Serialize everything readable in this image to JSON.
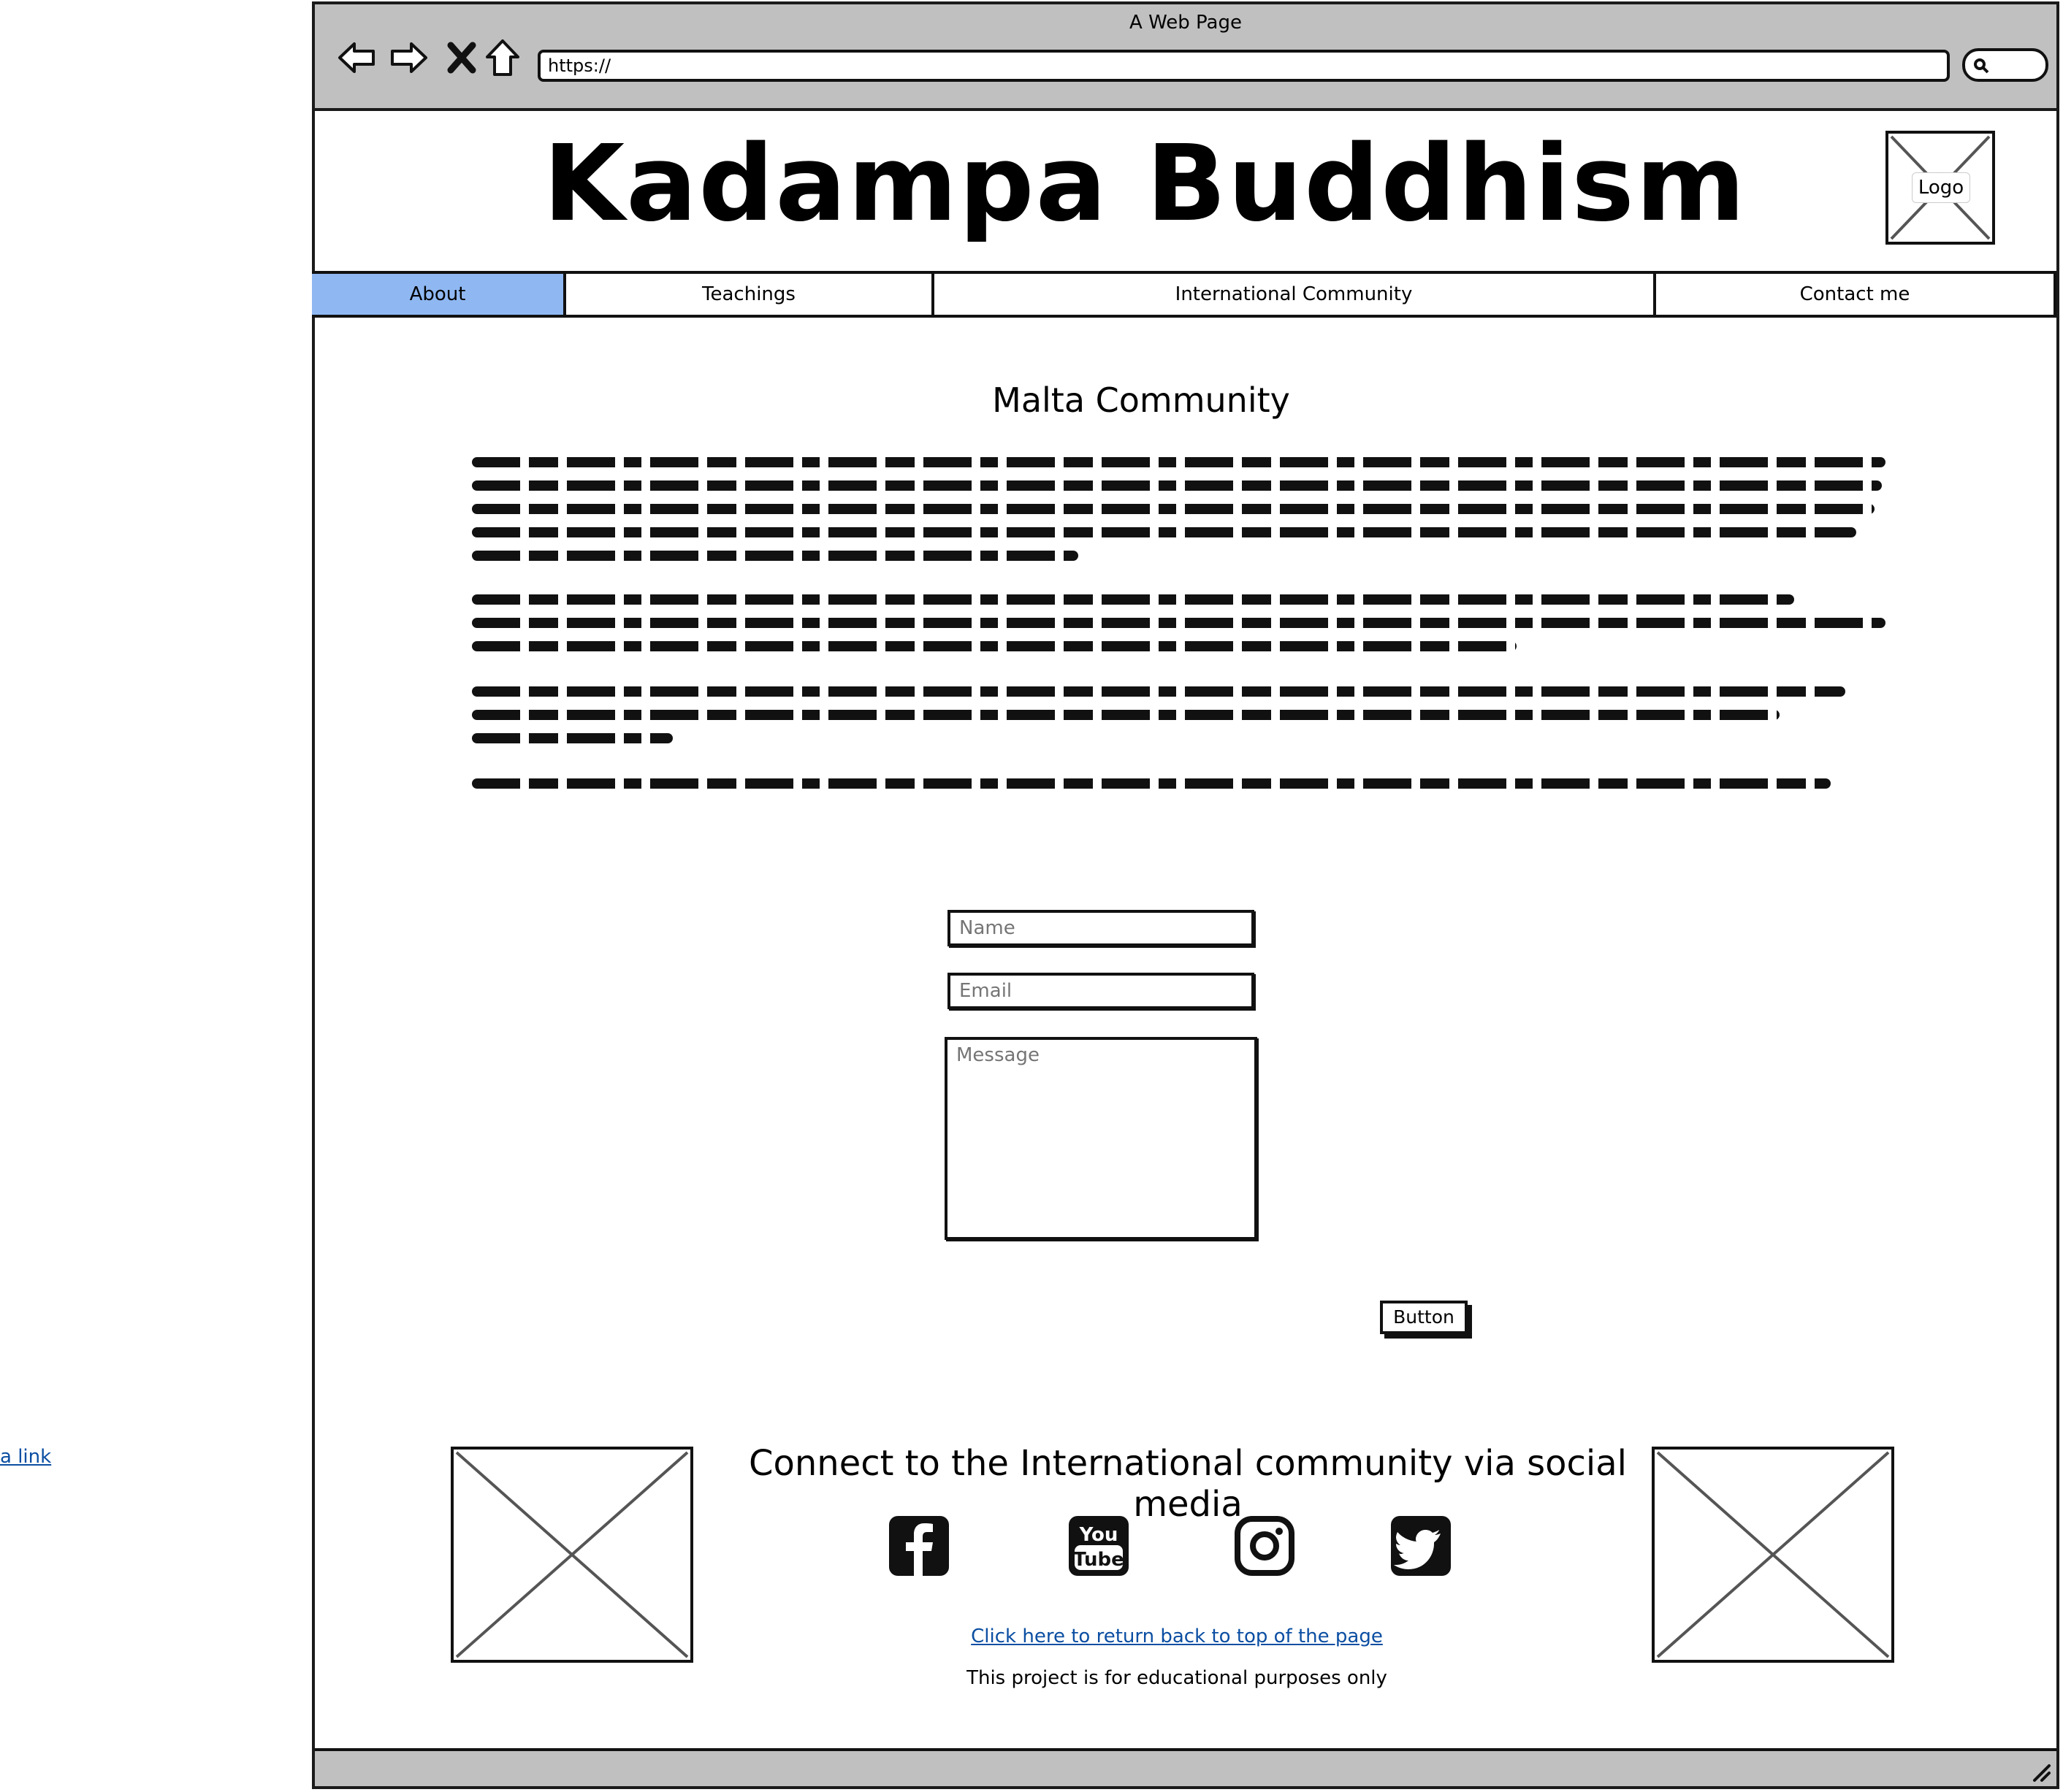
{
  "outside_link": "a link",
  "browser": {
    "window_title": "A Web Page",
    "url": "https://"
  },
  "header": {
    "site_title": "Kadampa Buddhism",
    "logo_label": "Logo"
  },
  "nav": {
    "items": [
      {
        "label": "About",
        "active": true
      },
      {
        "label": "Teachings",
        "active": false
      },
      {
        "label": "International Community",
        "active": false
      },
      {
        "label": "Contact me",
        "active": false
      }
    ]
  },
  "main": {
    "section_title": "Malta Community"
  },
  "form": {
    "name_placeholder": "Name",
    "email_placeholder": "Email",
    "message_placeholder": "Message",
    "button_label": "Button"
  },
  "footer": {
    "social_title": "Connect to the International community via social media",
    "social_icons": [
      "facebook-icon",
      "youtube-icon",
      "instagram-icon",
      "twitter-icon"
    ],
    "return_link": "Click here to return back to top of the page",
    "note": "This project is for educational purposes only"
  },
  "colors": {
    "active_nav": "#8fb8f2",
    "chrome": "#c0c0c0",
    "link": "#0b4ea2"
  }
}
